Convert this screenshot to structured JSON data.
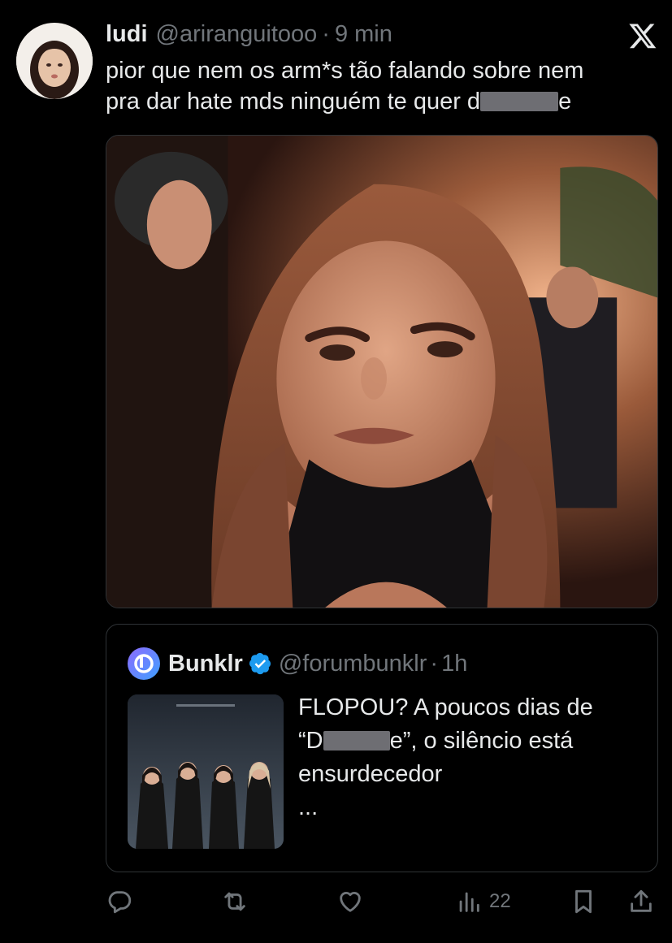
{
  "post": {
    "author_name": "ludi",
    "author_handle": "@ariranguitooo",
    "separator": "·",
    "time": "9 min",
    "text_line1": "pior que nem os arm*s tão falando sobre nem",
    "text_line2_before": "pra dar hate mds ninguém te quer d",
    "text_line2_after": "e"
  },
  "quote": {
    "author_name": "Bunklr",
    "author_handle": "@forumbunklr",
    "separator": "·",
    "time": "1h",
    "line1": "FLOPOU? A poucos dias de",
    "line2_before": "“D",
    "line2_after": "e”, o silêncio está",
    "line3": "ensurdecedor",
    "ellipsis": "..."
  },
  "actions": {
    "views_count": "22"
  },
  "icons": {
    "brand": "x-logo-icon",
    "verified": "verified-badge-icon",
    "reply": "reply-icon",
    "repost": "repost-icon",
    "like": "like-icon",
    "views": "views-icon",
    "bookmark": "bookmark-icon",
    "share": "share-icon"
  },
  "colors": {
    "background": "#000000",
    "text": "#e7e9ea",
    "secondary": "#71767b",
    "border": "#2f3336",
    "verified": "#1d9bf0"
  }
}
